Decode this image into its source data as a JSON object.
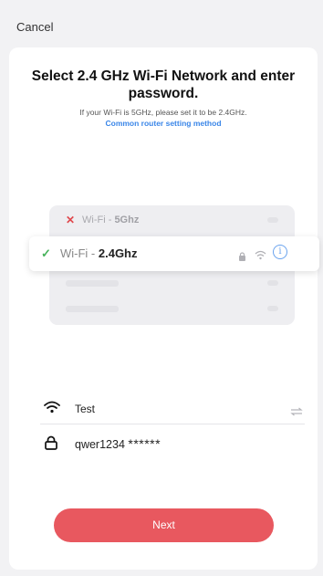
{
  "header": {
    "cancel_label": "Cancel"
  },
  "main": {
    "title": "Select 2.4 GHz Wi-Fi Network and enter password.",
    "subtitle": "If your Wi-Fi is 5GHz, please set it to be 2.4GHz.",
    "router_link": "Common router setting method"
  },
  "illustration": {
    "network_5g_prefix": "Wi-Fi - ",
    "network_5g_band": "5Ghz",
    "network_24_prefix": "Wi-Fi - ",
    "network_24_band": "2.4Ghz",
    "colors": {
      "error": "#e0484d",
      "ok": "#47b25b",
      "info": "#6aa3ee"
    }
  },
  "form": {
    "ssid_value": "Test",
    "password_value": "qwer1234",
    "password_mask": "******"
  },
  "actions": {
    "next_label": "Next"
  },
  "colors": {
    "accent": "#e8585f",
    "link": "#3a86e8"
  }
}
